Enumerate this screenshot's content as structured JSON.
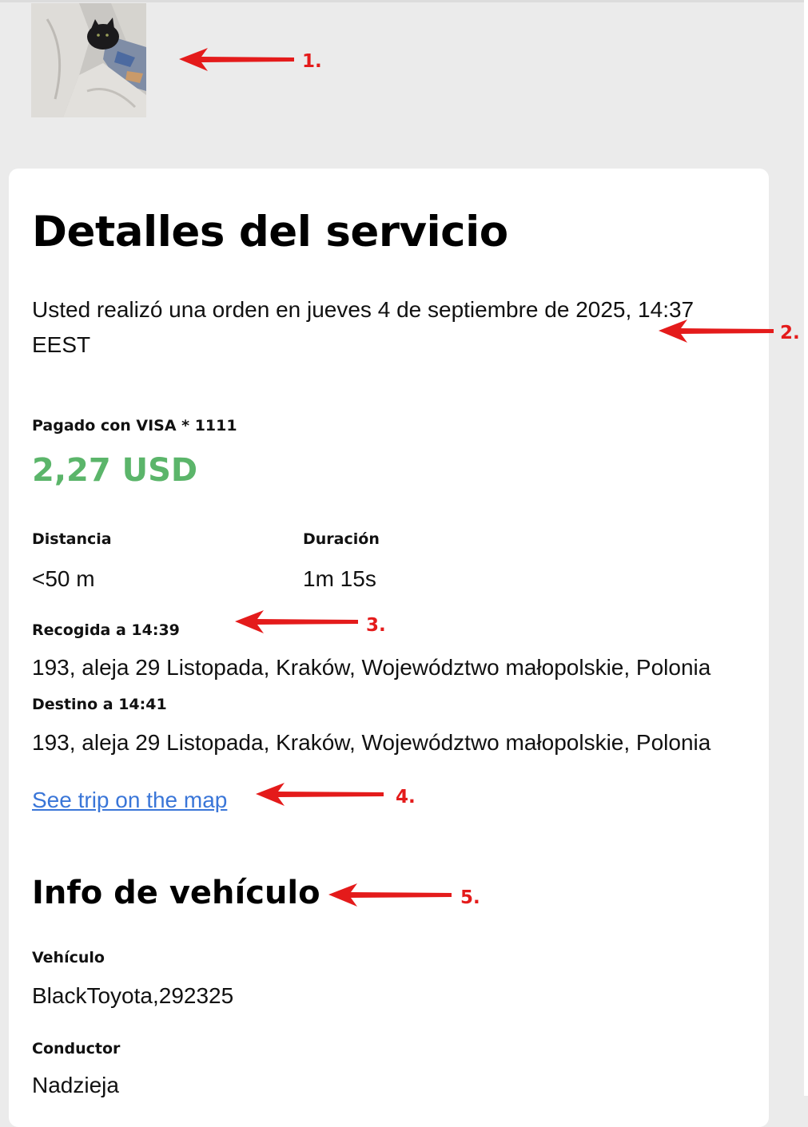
{
  "profile": {
    "avatar_icon": "cat-photo-icon"
  },
  "service": {
    "title": "Detalles del servicio",
    "order_text": "Usted realizó una orden en jueves 4 de septiembre de 2025, 14:37 EEST",
    "payment_label": "Pagado con VISA * 1111",
    "price": "2,27 USD",
    "price_color": "#5bb56a",
    "distance_label": "Distancia",
    "distance_value": "<50 m",
    "duration_label": "Duración",
    "duration_value": "1m 15s",
    "pickup_label": "Recogida a 14:39",
    "pickup_address": "193, aleja 29 Listopada, Kraków, Województwo małopolskie, Polonia",
    "dropoff_label": "Destino a 14:41",
    "dropoff_address": "193, aleja 29 Listopada, Kraków, Województwo małopolskie, Polonia",
    "map_link": "See trip on the map",
    "link_color": "#3a76d8"
  },
  "vehicle": {
    "title": "Info de vehículo",
    "vehicle_label": "Vehículo",
    "vehicle_value": "BlackToyota,292325",
    "driver_label": "Conductor",
    "driver_value": "Nadzieja"
  },
  "annotations": {
    "color": "#e41b1b",
    "markers": [
      "1.",
      "2.",
      "3.",
      "4.",
      "5."
    ]
  }
}
